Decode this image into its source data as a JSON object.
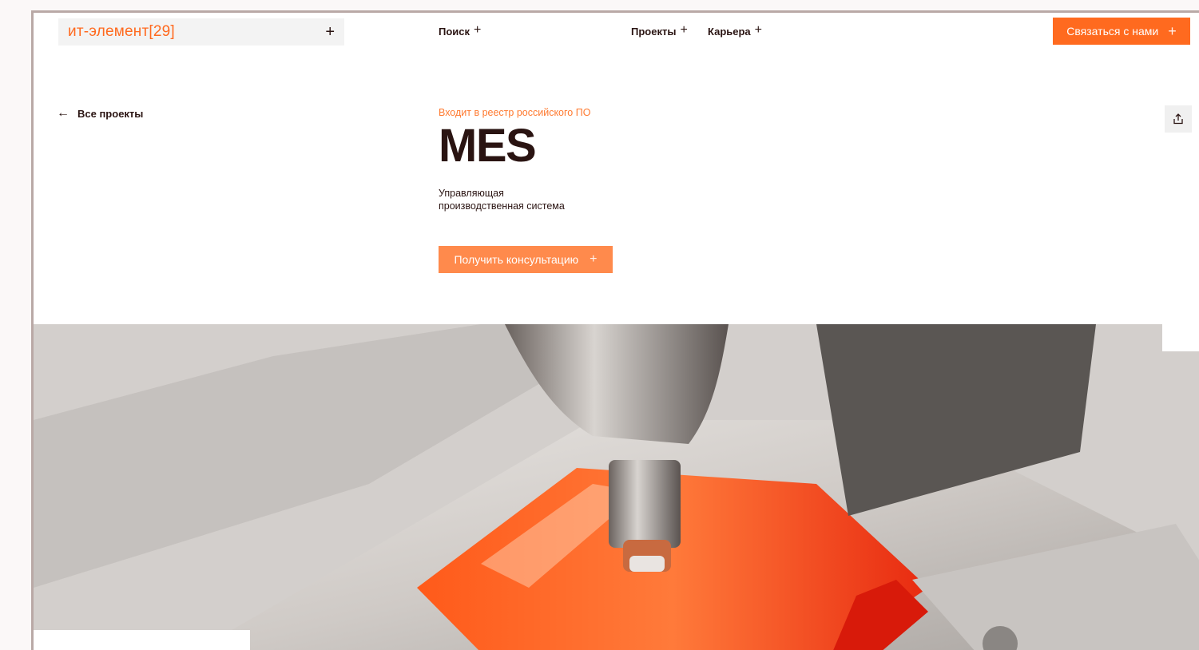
{
  "header": {
    "logo": "ит-элемент[29]",
    "nav": [
      {
        "label": "Поиск"
      },
      {
        "label": "Проекты"
      },
      {
        "label": "Карьера"
      }
    ],
    "contact_button": "Связаться с нами"
  },
  "main": {
    "back_link": "Все проекты",
    "badge": "Входит в реестр российского ПО",
    "title": "MES",
    "subtitle_line1": "Управляющая",
    "subtitle_line2": "производственная система",
    "consult_button": "Получить консультацию"
  },
  "colors": {
    "accent": "#ff6a1f",
    "button_light": "#ff8a4c",
    "text_dark": "#2a1412"
  },
  "icons": [
    "plus-icon",
    "arrow-left-icon",
    "share-icon"
  ]
}
